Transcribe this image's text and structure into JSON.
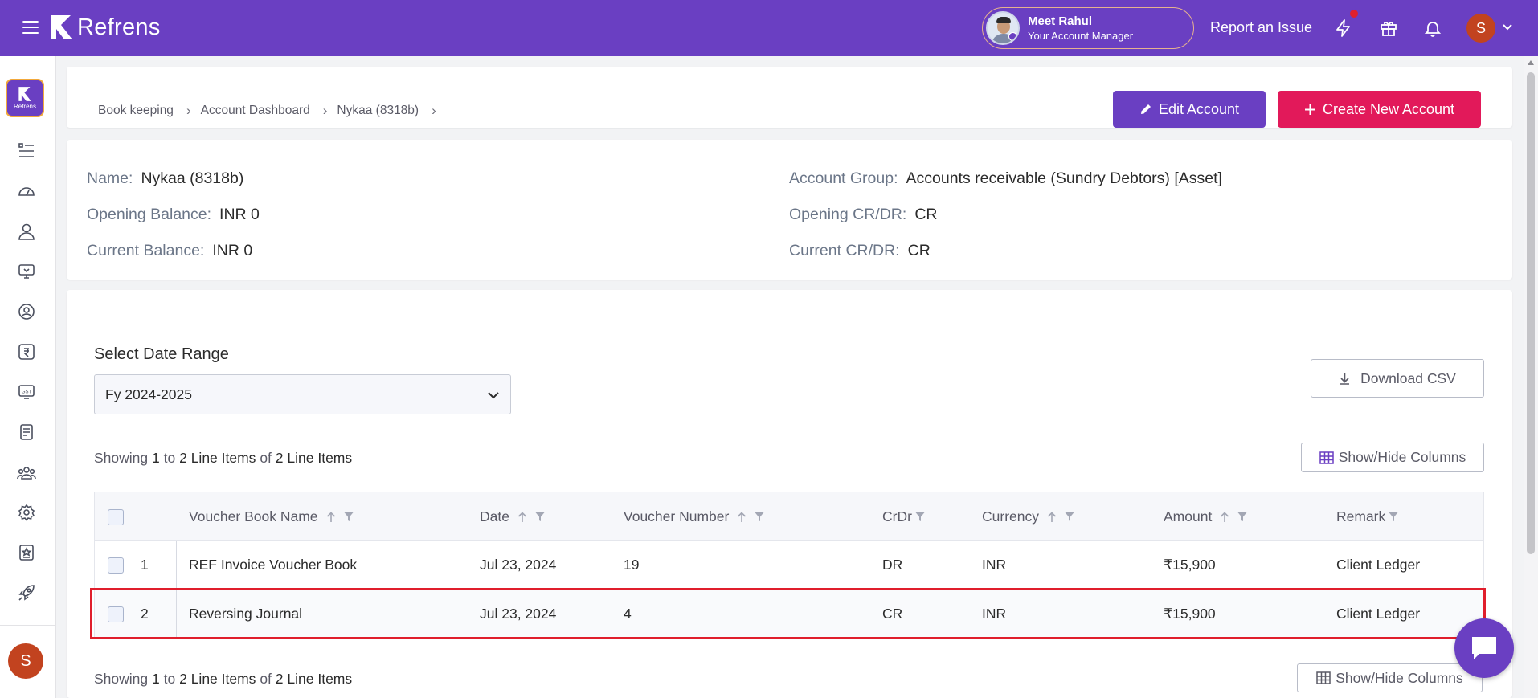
{
  "topbar": {
    "brand": "Refrens",
    "manager_name": "Meet Rahul",
    "manager_role": "Your Account Manager",
    "report_label": "Report an Issue",
    "user_initial": "S"
  },
  "sidebar": {
    "logo_text": "Refrens",
    "icons": [
      "list-icon",
      "dashboard-icon",
      "person-icon",
      "monitor-icon",
      "user-circle-icon",
      "rupee-icon",
      "gst-icon",
      "document-icon",
      "team-icon",
      "settings-icon",
      "badge-icon",
      "rocket-icon"
    ],
    "gst_label": "GST",
    "user_initial": "S"
  },
  "breadcrumb": [
    "Book keeping",
    "Account Dashboard",
    "Nykaa (8318b)"
  ],
  "actions": {
    "edit_label": "Edit Account",
    "create_label": "Create New Account"
  },
  "account": {
    "name_label": "Name:",
    "name_value": "Nykaa (8318b)",
    "opening_balance_label": "Opening Balance:",
    "opening_balance_value": "INR 0",
    "current_balance_label": "Current Balance:",
    "current_balance_value": "INR 0",
    "group_label": "Account Group:",
    "group_value": "Accounts receivable (Sundry Debtors) [Asset]",
    "opening_crdr_label": "Opening CR/DR:",
    "opening_crdr_value": "CR",
    "current_crdr_label": "Current CR/DR:",
    "current_crdr_value": "CR"
  },
  "filters": {
    "date_range_label": "Select Date Range",
    "date_range_value": "Fy 2024-2025",
    "download_label": "Download CSV",
    "show_hide_label": "Show/Hide Columns"
  },
  "summary": {
    "prefix": "Showing",
    "from": "1",
    "to_word": "to",
    "to": "2 Line Items",
    "of_word": "of",
    "total": "2 Line Items"
  },
  "table": {
    "columns": [
      "Voucher Book Name",
      "Date",
      "Voucher Number",
      "CrDr",
      "Currency",
      "Amount",
      "Remark"
    ],
    "rows": [
      {
        "index": "1",
        "voucher_book": "REF Invoice Voucher Book",
        "date": "Jul 23, 2024",
        "voucher_number": "19",
        "crdr": "DR",
        "currency": "INR",
        "amount": "₹15,900",
        "remark": "Client Ledger"
      },
      {
        "index": "2",
        "voucher_book": "Reversing Journal",
        "date": "Jul 23, 2024",
        "voucher_number": "4",
        "crdr": "CR",
        "currency": "INR",
        "amount": "₹15,900",
        "remark": "Client Ledger"
      }
    ]
  },
  "colors": {
    "brand_purple": "#6a3fc2",
    "create_pink": "#e2195a",
    "highlight_red": "#e01e2c"
  }
}
